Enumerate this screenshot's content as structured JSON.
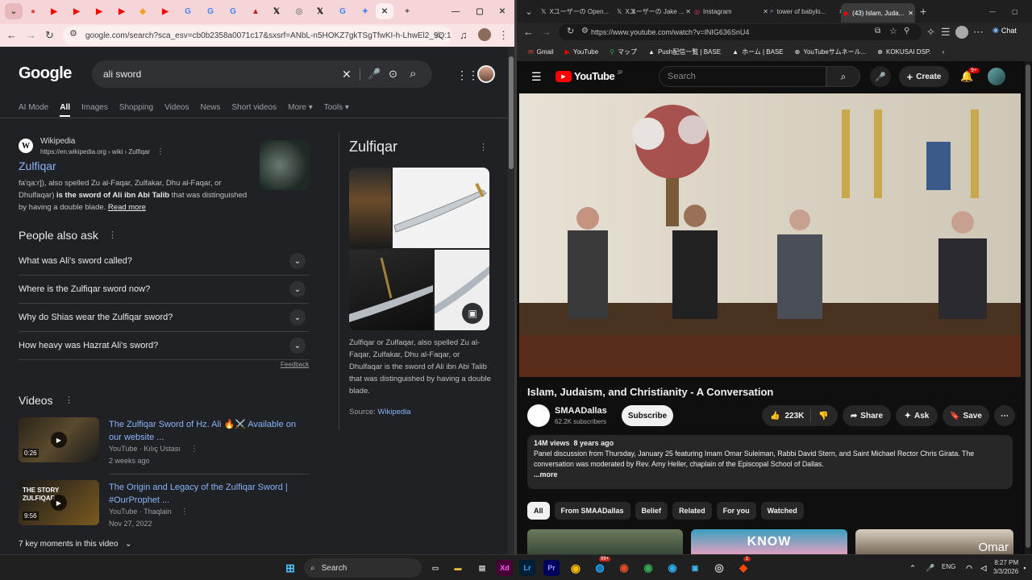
{
  "left_window": {
    "address": "google.com/search?sca_esv=cb0b2358a0071c17&sxsrf=ANbL-n5HOKZ7gkTSgTfwKI-h-LhwEl2_9Q:17...",
    "search": {
      "query": "ali sword",
      "logo": "Google"
    },
    "tabs": [
      "AI Mode",
      "All",
      "Images",
      "Shopping",
      "Videos",
      "News",
      "Short videos",
      "More",
      "Tools"
    ],
    "result": {
      "source": "Wikipedia",
      "url": "https://en.wikipedia.org › wiki › Zulfiqar",
      "title": "Zulfiqar",
      "snippet_1": "fa'qa:r]), also spelled Zu al-Faqar, Zulfakar, Dhu al-Faqar, or Dhulfaqar)",
      "snippet_bold": "is the sword of Ali ibn Abi Talib",
      "snippet_2": "that was distinguished by having a double blade.",
      "read_more": "Read more"
    },
    "paa": {
      "heading": "People also ask",
      "questions": [
        "What was Ali's sword called?",
        "Where is the Zulfiqar sword now?",
        "Why do Shias wear the Zulfiqar sword?",
        "How heavy was Hazrat Ali's sword?"
      ],
      "feedback": "Feedback"
    },
    "videos": {
      "heading": "Videos",
      "items": [
        {
          "title": "The Zulfiqar Sword of Hz. Ali 🔥⚔️ Available on our website ...",
          "channel": "YouTube · Kılıç Ustası",
          "date": "2 weeks ago",
          "duration": "0:26"
        },
        {
          "title": "The Origin and Legacy of the Zulfiqar Sword | #OurProphet ...",
          "channel": "YouTube · Thaqlain",
          "date": "Nov 27, 2022",
          "duration": "9:56",
          "thumb_text": "THE STORY ZULFIQAR"
        }
      ],
      "key_moments": "7 key moments in this video"
    },
    "panel": {
      "title": "Zulfiqar",
      "description": "Zulfiqar or Zulfaqar, also spelled Zu al-Faqar, Zulfakar, Dhu al-Faqar, or Dhulfaqar is the sword of Ali ibn Abi Talib that was distinguished by having a double blade.",
      "source_label": "Source:",
      "source": "Wikipedia"
    }
  },
  "right_window": {
    "tabs": [
      "Xユーザーの Open...",
      "Xユーザーの Jake ...",
      "Instagram",
      "tower of babylo...",
      "(43) Islam, Juda..."
    ],
    "address": "https://www.youtube.com/watch?v=lNIG636SnU4",
    "chat": "Chat",
    "bookmarks": [
      "Gmail",
      "YouTube",
      "マップ",
      "Push配信一覧 | BASE",
      "ホーム | BASE",
      "YouTubeサムネール...",
      "KOKUSAI DSP."
    ],
    "youtube": {
      "logo": "YouTube",
      "region": "JP",
      "search_placeholder": "Search",
      "create": "Create",
      "notif_count": "9+",
      "video_title": "Islam, Judaism, and Christianity - A Conversation",
      "channel": "SMAADallas",
      "subscribers": "62.2K subscribers",
      "subscribe": "Subscribe",
      "likes": "223K",
      "share": "Share",
      "ask": "Ask",
      "save": "Save",
      "views": "14M views",
      "age": "8 years ago",
      "description": "Panel discussion from Thursday, January 25 featuring Imam Omar Suleiman, Rabbi David Stern, and Saint Michael Rector Chris Girata. The conversation was moderated by Rev. Amy Heller, chaplain of the Episcopal School of Dallas.",
      "more": "...more",
      "chips": [
        "All",
        "From SMAADallas",
        "Belief",
        "Related",
        "For you",
        "Watched"
      ],
      "rec_thumb_text": "KNOW",
      "rec_caption": "Omar"
    }
  },
  "taskbar": {
    "search": "Search",
    "lang": "ENG",
    "time": "8:27 PM",
    "date": "3/3/2026",
    "badges": [
      "99+",
      "1"
    ]
  }
}
